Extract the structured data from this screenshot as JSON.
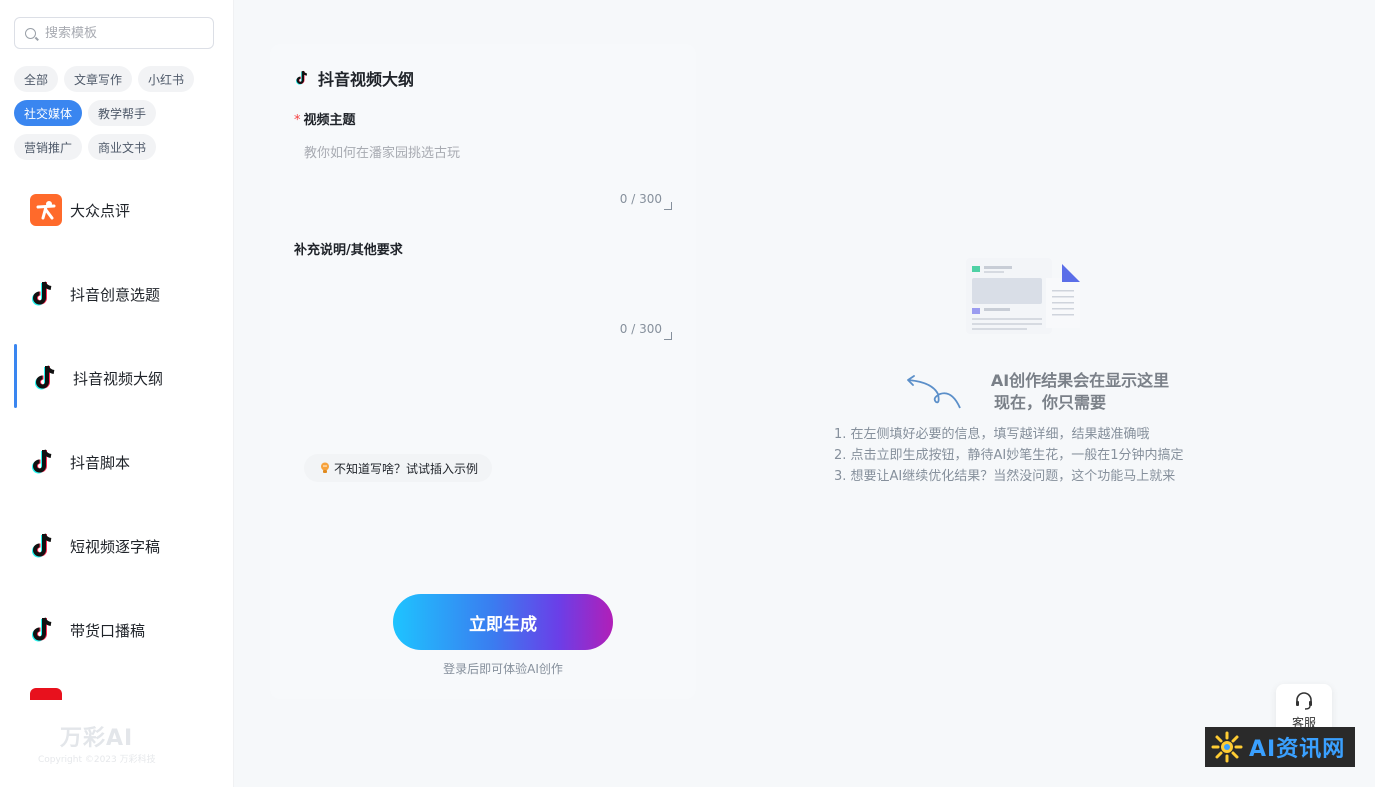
{
  "sidebar": {
    "search_placeholder": "搜索模板",
    "tags_row1": [
      "全部",
      "文章写作",
      "小红书"
    ],
    "tags_row2": [
      "社交媒体",
      "教学帮手"
    ],
    "tags_row3": [
      "营销推广",
      "商业文书"
    ],
    "active_tag": "社交媒体",
    "tools": [
      {
        "label": "大众点评",
        "icon": "dianping-icon"
      },
      {
        "label": "抖音创意选题",
        "icon": "tiktok-icon"
      },
      {
        "label": "抖音视频大纲",
        "icon": "tiktok-icon"
      },
      {
        "label": "抖音脚本",
        "icon": "tiktok-icon"
      },
      {
        "label": "短视频逐字稿",
        "icon": "tiktok-icon"
      },
      {
        "label": "带货口播稿",
        "icon": "tiktok-icon"
      }
    ],
    "active_tool": "抖音视频大纲",
    "logo_text": "万彩AI",
    "copyright": "Copyright ©2023 万彩科技"
  },
  "form": {
    "title": "抖音视频大纲",
    "field1_required_mark": "*",
    "field1_label": "视频主题",
    "field1_placeholder": "教你如何在潘家园挑选古玩",
    "field1_counter": "0 / 300",
    "field2_label": "补充说明/其他要求",
    "field2_placeholder": "",
    "field2_counter": "0 / 300",
    "example_button": "不知道写啥？试试插入示例",
    "generate_button": "立即生成",
    "login_tip": "登录后即可体验AI创作"
  },
  "result": {
    "title_line1": "AI创作结果会在显示这里",
    "title_line2": "现在，你只需要",
    "steps": [
      "1. 在左侧填好必要的信息，填写越详细，结果越准确哦",
      "2. 点击立即生成按钮，静待AI妙笔生花，一般在1分钟内搞定",
      "3. 想要让AI继续优化结果？当然没问题，这个功能马上就来"
    ]
  },
  "service": {
    "label": "客服",
    "icon": "headset-icon"
  },
  "watermark": {
    "text": "AI资讯网"
  },
  "colors": {
    "accent": "#3a86f0",
    "required": "#f53f3f",
    "dianping": "#ff6a2b"
  }
}
